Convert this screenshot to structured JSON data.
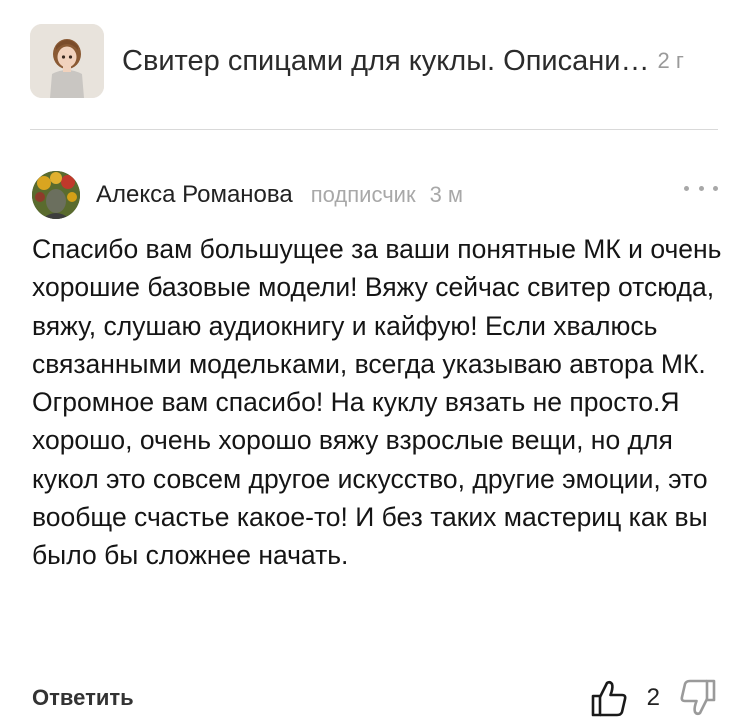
{
  "article": {
    "title": "Свитер спицами для куклы. Описани…",
    "age": "2 г",
    "thumbnail_icon": "doll-photo"
  },
  "comment": {
    "author": "Алекса Романова",
    "role": "подписчик",
    "time": "3 м",
    "avatar_icon": "avatar-photo",
    "more_icon": "more-dots-icon",
    "text": "Спасибо вам большущее за ваши понятные МК и очень хорошие базовые модели! Вяжу сейчас свитер отсюда, вяжу, слушаю аудиокнигу и кайфую! Если хвалюсь связанными модельками, всегда указываю автора МК. Огромное вам спасибо! На куклу вязать не просто.Я хорошо, очень хорошо вяжу взрослые вещи, но для кукол это совсем другое искусство, другие эмоции, это вообще счастье какое-то! И без таких мастериц как вы было бы сложнее начать."
  },
  "actions": {
    "reply_label": "Ответить",
    "likes": "2",
    "like_icon": "thumbs-up-icon",
    "dislike_icon": "thumbs-down-icon"
  },
  "colors": {
    "secondary_text": "#a8a8a8",
    "divider": "#d9d9d9"
  }
}
